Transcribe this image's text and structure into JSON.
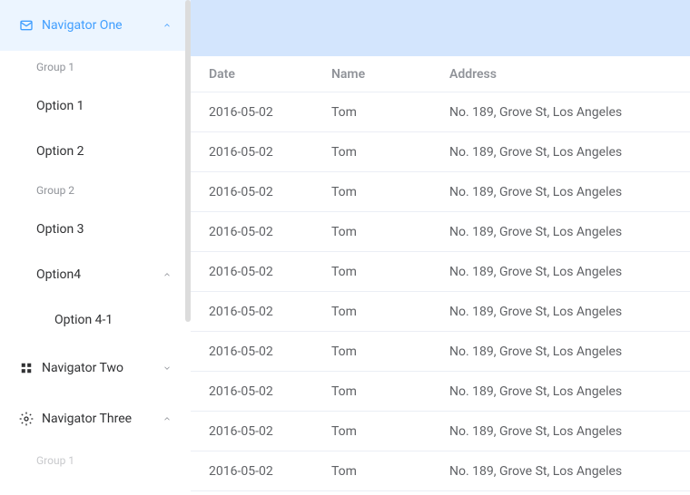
{
  "sidebar": {
    "nav1": {
      "label": "Navigator One"
    },
    "group1": "Group 1",
    "option1": "Option 1",
    "option2": "Option 2",
    "group2": "Group 2",
    "option3": "Option 3",
    "option4": "Option4",
    "option4_1": "Option 4-1",
    "nav2": {
      "label": "Navigator Two"
    },
    "nav3": {
      "label": "Navigator Three"
    },
    "group1b": "Group 1"
  },
  "table": {
    "headers": {
      "date": "Date",
      "name": "Name",
      "address": "Address"
    },
    "rows": [
      {
        "date": "2016-05-02",
        "name": "Tom",
        "address": "No. 189, Grove St, Los Angeles"
      },
      {
        "date": "2016-05-02",
        "name": "Tom",
        "address": "No. 189, Grove St, Los Angeles"
      },
      {
        "date": "2016-05-02",
        "name": "Tom",
        "address": "No. 189, Grove St, Los Angeles"
      },
      {
        "date": "2016-05-02",
        "name": "Tom",
        "address": "No. 189, Grove St, Los Angeles"
      },
      {
        "date": "2016-05-02",
        "name": "Tom",
        "address": "No. 189, Grove St, Los Angeles"
      },
      {
        "date": "2016-05-02",
        "name": "Tom",
        "address": "No. 189, Grove St, Los Angeles"
      },
      {
        "date": "2016-05-02",
        "name": "Tom",
        "address": "No. 189, Grove St, Los Angeles"
      },
      {
        "date": "2016-05-02",
        "name": "Tom",
        "address": "No. 189, Grove St, Los Angeles"
      },
      {
        "date": "2016-05-02",
        "name": "Tom",
        "address": "No. 189, Grove St, Los Angeles"
      },
      {
        "date": "2016-05-02",
        "name": "Tom",
        "address": "No. 189, Grove St, Los Angeles"
      }
    ]
  }
}
